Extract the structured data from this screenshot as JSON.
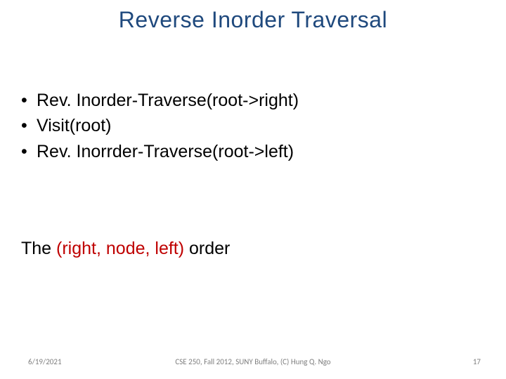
{
  "title": "Reverse Inorder Traversal",
  "bullets": {
    "dot": "•",
    "items": [
      "Rev. Inorder-Traverse(root->right)",
      "Visit(root)",
      "Rev. Inorrder-Traverse(root->left)"
    ]
  },
  "summary": {
    "prefix": "The ",
    "highlight": "(right, node, left)",
    "suffix": " order"
  },
  "footer": {
    "date": "6/19/2021",
    "center": "CSE 250, Fall 2012, SUNY Buffalo, (C) Hung Q. Ngo",
    "page": "17"
  }
}
